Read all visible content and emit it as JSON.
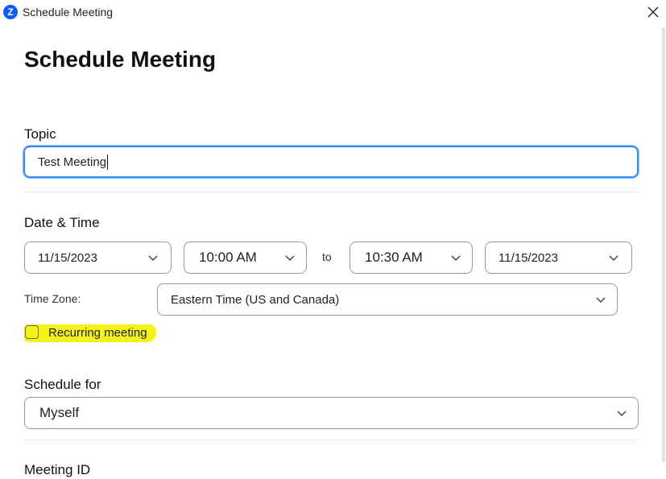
{
  "window": {
    "title": "Schedule Meeting",
    "logo_letter": "Z"
  },
  "page": {
    "heading": "Schedule Meeting"
  },
  "topic": {
    "label": "Topic",
    "value": "Test Meeting"
  },
  "date_time": {
    "label": "Date & Time",
    "start_date": "11/15/2023",
    "start_time": "10:00 AM",
    "to_label": "to",
    "end_time": "10:30 AM",
    "end_date": "11/15/2023"
  },
  "time_zone": {
    "label": "Time Zone:",
    "value": "Eastern Time (US and Canada)"
  },
  "recurring": {
    "label": "Recurring meeting",
    "checked": false,
    "highlight_color": "#f3f31a"
  },
  "schedule_for": {
    "label": "Schedule for",
    "value": "Myself"
  },
  "meeting_id": {
    "label": "Meeting ID"
  },
  "colors": {
    "focus_border": "#2d8cff",
    "brand": "#0b5cff"
  },
  "icons": {
    "close": "close-icon",
    "chevron": "chevron-down-icon",
    "logo": "zoom-logo-icon"
  }
}
